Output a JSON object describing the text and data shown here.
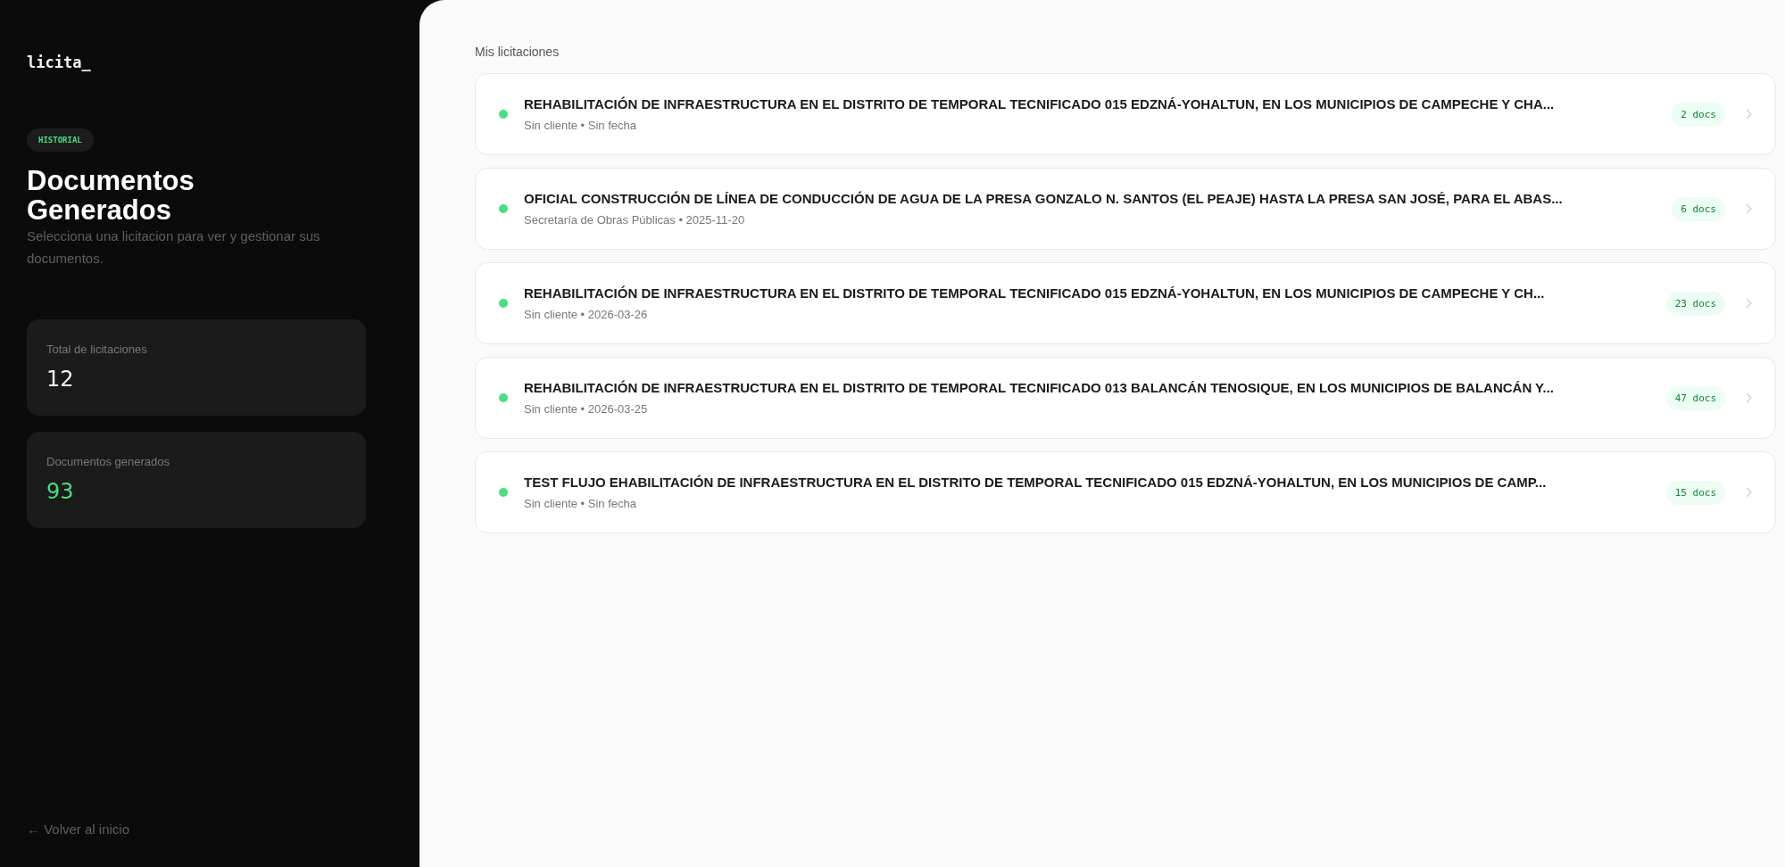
{
  "sidebar": {
    "logo": "licita_",
    "badge": "HISTORIAL",
    "title": "Documentos Generados",
    "subtitle": "Selecciona una licitacion para ver y gestionar sus documentos.",
    "stats": [
      {
        "label": "Total de licitaciones",
        "value": "12",
        "kind": "plain"
      },
      {
        "label": "Documentos generados",
        "value": "93",
        "kind": "accent"
      }
    ],
    "back_link": "← Volver al inicio"
  },
  "main": {
    "heading": "Mis licitaciones",
    "items": [
      {
        "title": "REHABILITACIÓN DE INFRAESTRUCTURA EN EL DISTRITO DE TEMPORAL TECNIFICADO 015 EDZNÁ-YOHALTUN, EN LOS MUNICIPIOS DE CAMPECHE Y CHA...",
        "meta": "Sin cliente • Sin fecha",
        "docs": "2 docs"
      },
      {
        "title": "OFICIAL CONSTRUCCIÓN DE LÍNEA DE CONDUCCIÓN DE AGUA DE LA PRESA GONZALO N. SANTOS (EL PEAJE) HASTA LA PRESA SAN JOSÉ, PARA EL ABAS...",
        "meta": "Secretaría de Obras Públicas • 2025-11-20",
        "docs": "6 docs"
      },
      {
        "title": "REHABILITACIÓN DE INFRAESTRUCTURA EN EL DISTRITO DE TEMPORAL TECNIFICADO 015 EDZNÁ-YOHALTUN, EN LOS MUNICIPIOS DE CAMPECHE Y CH...",
        "meta": "Sin cliente • 2026-03-26",
        "docs": "23 docs"
      },
      {
        "title": "REHABILITACIÓN DE INFRAESTRUCTURA EN EL DISTRITO DE TEMPORAL TECNIFICADO 013 BALANCÁN TENOSIQUE, EN LOS MUNICIPIOS DE BALANCÁN Y...",
        "meta": "Sin cliente • 2026-03-25",
        "docs": "47 docs"
      },
      {
        "title": "TEST FLUJO EHABILITACIÓN DE INFRAESTRUCTURA EN EL DISTRITO DE TEMPORAL TECNIFICADO 015 EDZNÁ-YOHALTUN, EN LOS MUNICIPIOS DE CAMP...",
        "meta": "Sin cliente • Sin fecha",
        "docs": "15 docs"
      }
    ]
  }
}
